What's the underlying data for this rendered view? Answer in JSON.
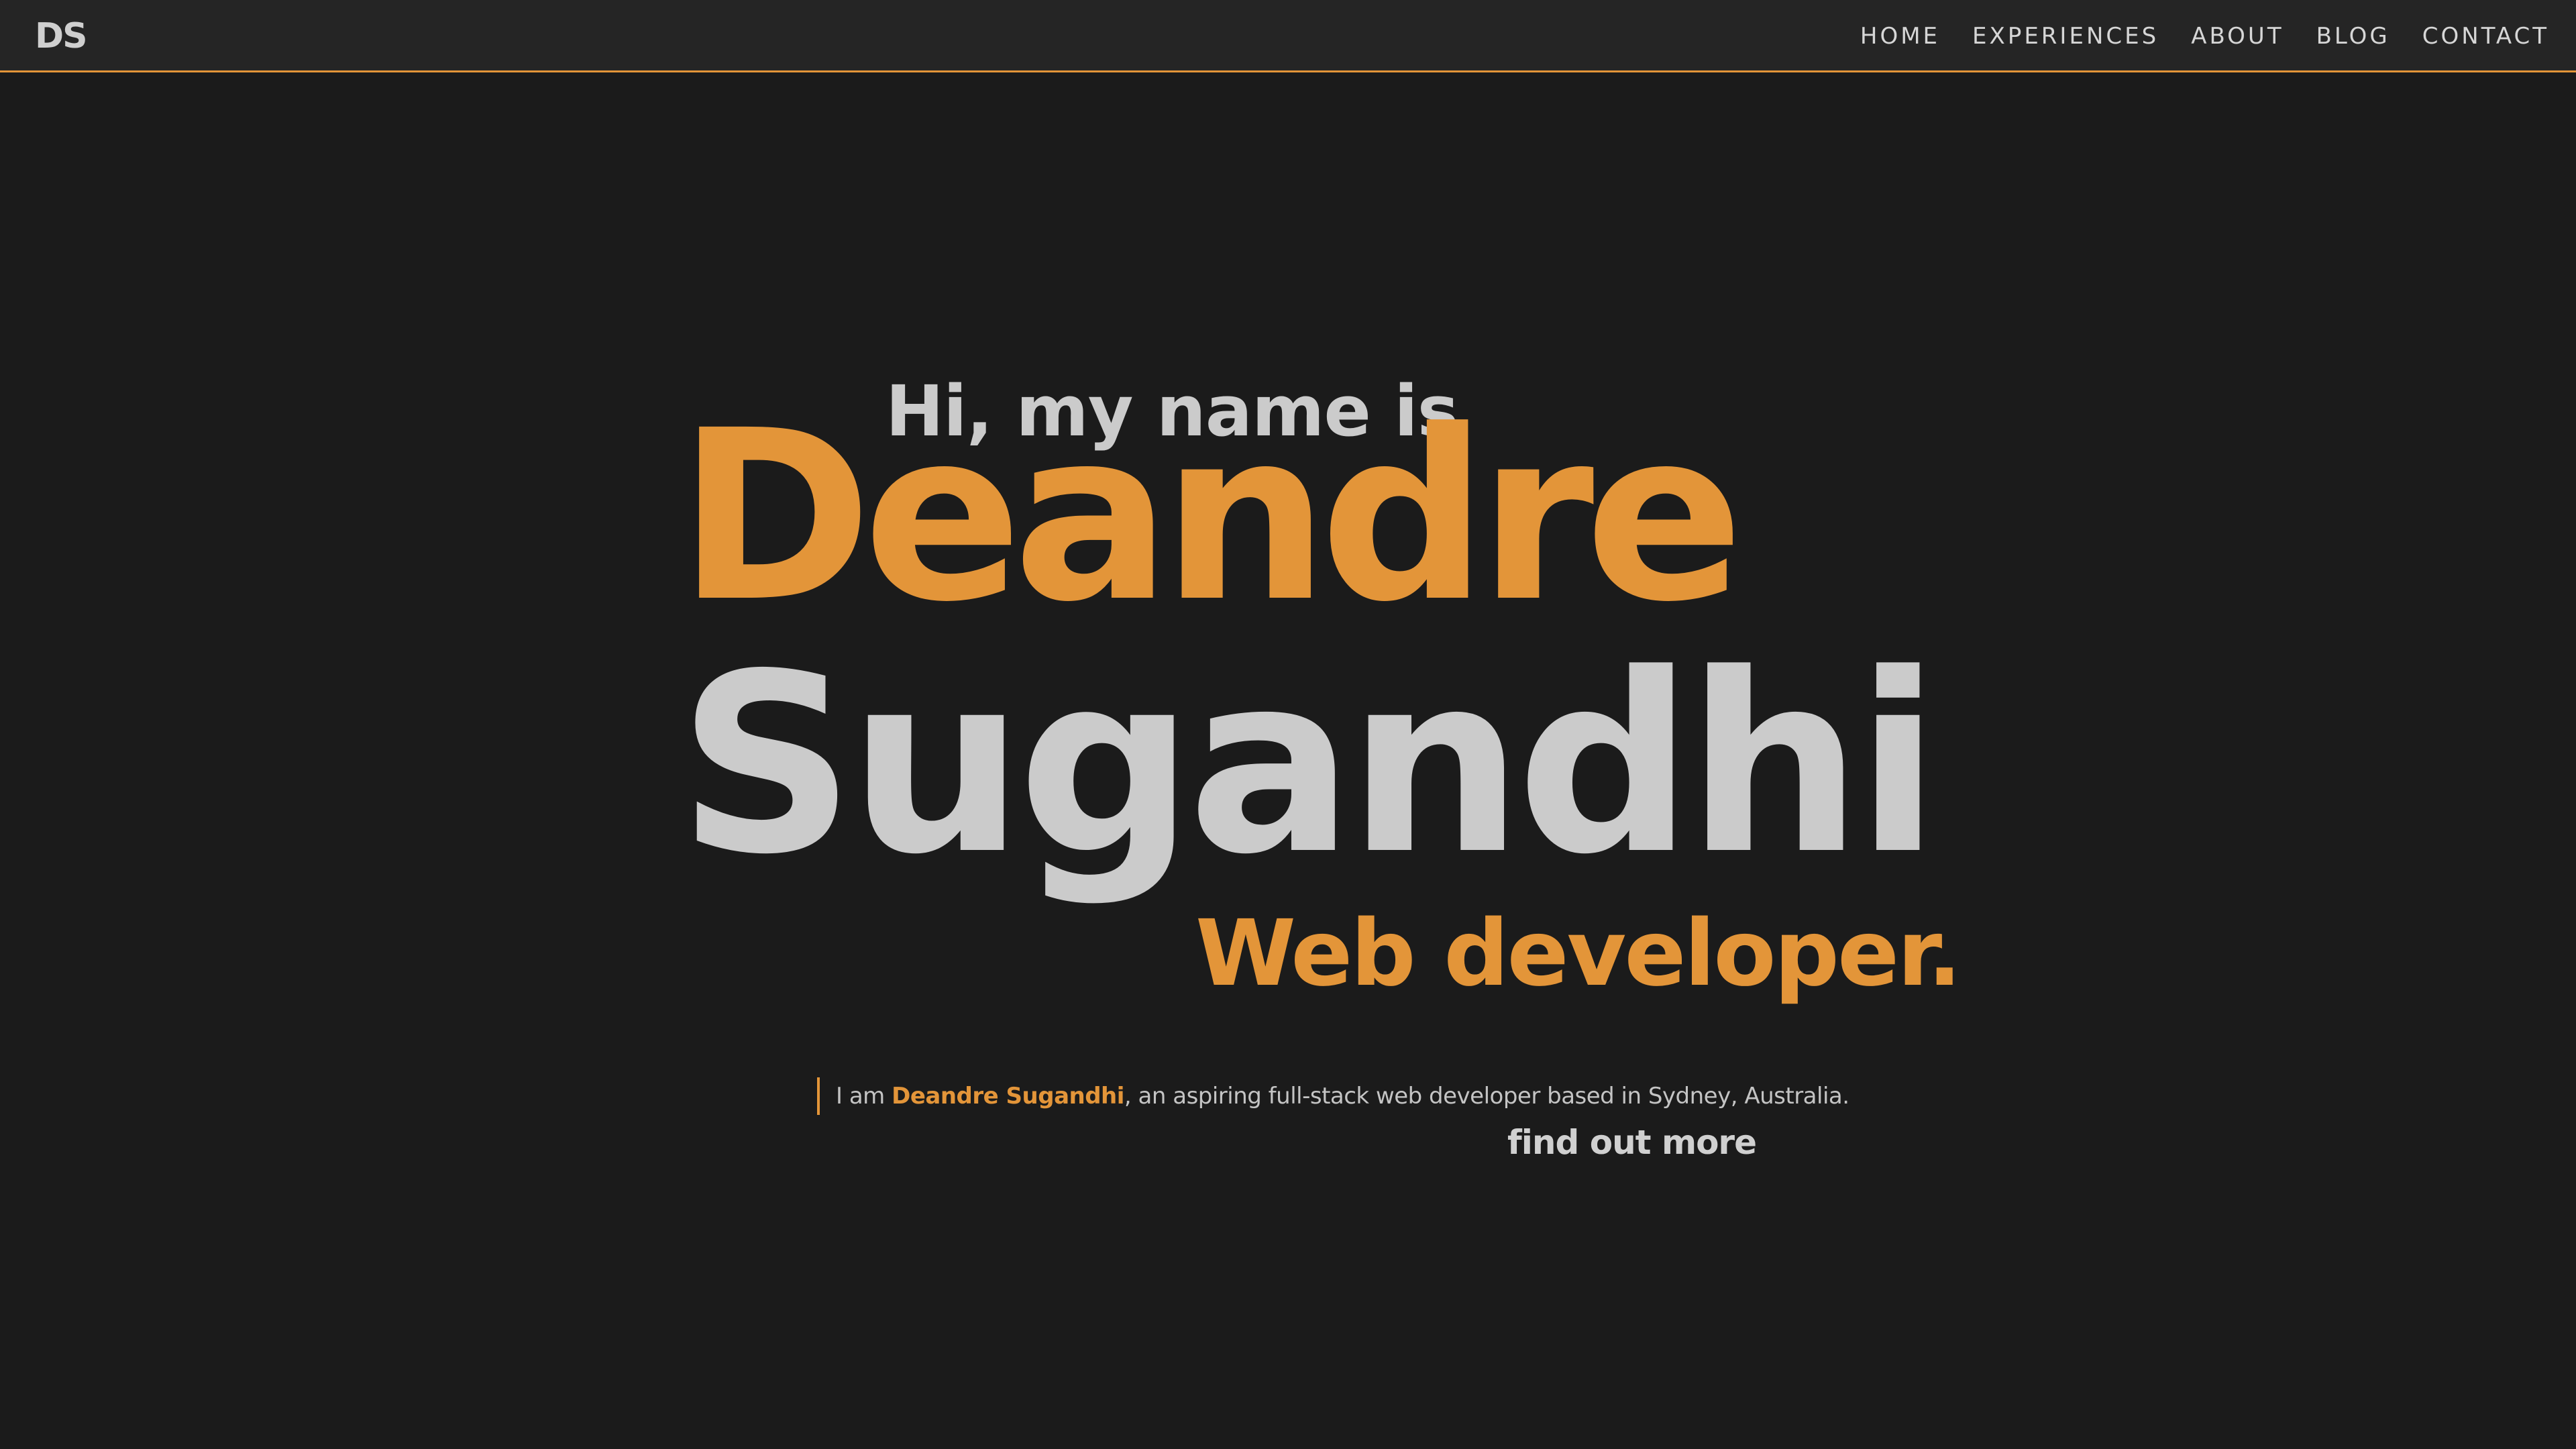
{
  "navbar": {
    "logo": "DS",
    "links": [
      {
        "label": "HOME"
      },
      {
        "label": "EXPERIENCES"
      },
      {
        "label": "ABOUT"
      },
      {
        "label": "BLOG"
      },
      {
        "label": "CONTACT"
      }
    ]
  },
  "hero": {
    "greeting": "Hi, my name is",
    "first_name": "Deandre",
    "last_name": "Sugandhi",
    "role": "Web developer.",
    "intro_prefix": "I am ",
    "intro_name": "Deandre Sugandhi",
    "intro_suffix": ", an aspiring full-stack web developer based in Sydney, Australia.",
    "cta_label": "find out more"
  },
  "colors": {
    "accent": "#e39539",
    "background": "#1b1b1b",
    "navbar_background": "#252525",
    "text_light": "#cbcbcb"
  }
}
